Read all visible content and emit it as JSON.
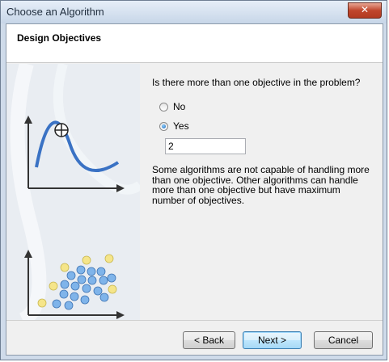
{
  "window": {
    "title": "Choose an Algorithm",
    "close_icon": "close-icon",
    "frame_color": "#cfdbea"
  },
  "header": {
    "title": "Design Objectives"
  },
  "question": "Is there more than one objective in the problem?",
  "options": [
    {
      "label": "No",
      "checked": false
    },
    {
      "label": "Yes",
      "checked": true
    }
  ],
  "objectives_count": "2",
  "info_text": "Some algorithms are not capable of handling more than one objective. Other algorithms can handle more than one objective but have maximum number of objectives.",
  "buttons": {
    "back": "< Back",
    "next": "Next >",
    "cancel": "Cancel"
  },
  "illustrations": {
    "single_objective": "single-objective-curve-icon",
    "multi_objective": "pareto-scatter-icon",
    "curve_color": "#3a72c4",
    "point_blue": "#7fb4ea",
    "point_yellow": "#f5e58a"
  }
}
